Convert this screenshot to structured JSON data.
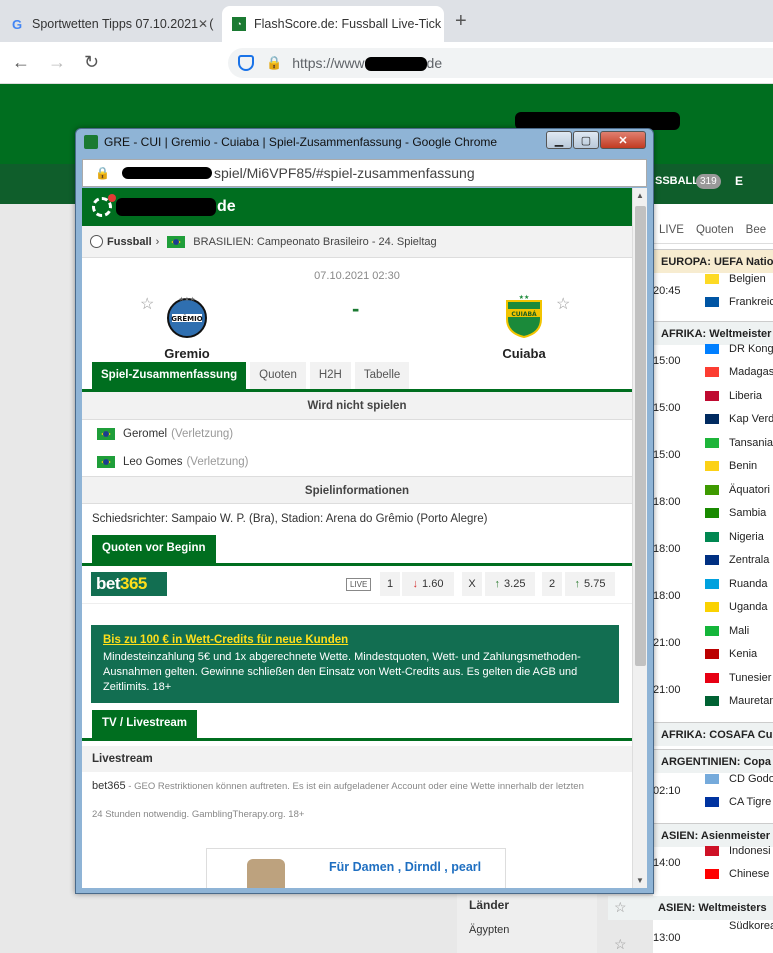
{
  "browser": {
    "tabs": [
      {
        "title": "Sportwetten Tipps 07.10.2021 - (",
        "icon": "google-icon"
      },
      {
        "title": "FlashScore.de: Fussball Live-Tick",
        "icon": "flashscore-icon"
      }
    ],
    "address": {
      "prefix": "https://www",
      "suffix": "de"
    }
  },
  "background_page": {
    "nav": {
      "football": "SSBALL",
      "count": "319",
      "other": "E"
    },
    "subtabs": [
      "LIVE",
      "Quoten",
      "Bee"
    ],
    "leagues": [
      {
        "name": "EUROPA: UEFA Natio",
        "style": "gold"
      },
      {
        "name": "AFRIKA: Weltmeister",
        "style": "plain"
      },
      {
        "name": "AFRIKA: COSAFA Cup",
        "style": "plain"
      },
      {
        "name": "ARGENTINIEN: Copa",
        "style": "plain"
      },
      {
        "name": "ASIEN: Asienmeister",
        "style": "plain"
      }
    ],
    "matches": [
      {
        "time": "20:45",
        "home": "Belgien",
        "away": "Frankreic"
      },
      {
        "time": "15:00",
        "home": "DR Kong",
        "away": "Madagas"
      },
      {
        "time": "15:00",
        "home": "Liberia",
        "away": "Kap Verd"
      },
      {
        "time": "15:00",
        "home": "Tansania",
        "away": "Benin"
      },
      {
        "time": "18:00",
        "home": "Äquatori",
        "away": "Sambia"
      },
      {
        "time": "18:00",
        "home": "Nigeria",
        "away": "Zentrala"
      },
      {
        "time": "18:00",
        "home": "Ruanda",
        "away": "Uganda"
      },
      {
        "time": "21:00",
        "home": "Mali",
        "away": "Kenia"
      },
      {
        "time": "21:00",
        "home": "Tunesier",
        "away": "Mauretan"
      },
      {
        "time": "02:10",
        "home": "CD Godo",
        "away": "CA Tigre"
      },
      {
        "time": "14:00",
        "home": "Indonesi",
        "away": "Chinese"
      },
      {
        "time": "13:00",
        "home": "Südkorea",
        "away": ""
      }
    ],
    "side": {
      "title": "Länder",
      "item": "Ägypten"
    },
    "asia_league": "ASIEN: Weltmeisters"
  },
  "popup": {
    "title": "GRE - CUI | Gremio - Cuiaba | Spiel-Zusammenfassung - Google Chrome",
    "url_suffix": "spiel/Mi6VPF85/#spiel-zusammenfassung",
    "logo_domain": "de",
    "breadcrumb": {
      "sport": "Fussball",
      "league": "BRASILIEN: Campeonato Brasileiro - 24. Spieltag"
    },
    "match": {
      "date": "07.10.2021 02:30",
      "home": "Gremio",
      "away": "Cuiaba",
      "score": "-"
    },
    "tabs": [
      "Spiel-Zusammenfassung",
      "Quoten",
      "H2H",
      "Tabelle"
    ],
    "not_playing": {
      "header": "Wird nicht spielen",
      "players": [
        {
          "name": "Geromel",
          "reason": "(Verletzung)"
        },
        {
          "name": "Leo Gomes",
          "reason": "(Verletzung)"
        }
      ]
    },
    "info": {
      "header": "Spielinformationen",
      "text": "Schiedsrichter: Sampaio W. P. (Bra), Stadion: Arena do Grêmio (Porto Alegre)"
    },
    "odds": {
      "header": "Quoten vor Beginn",
      "bookmaker": "bet365",
      "live": "LIVE",
      "home_label": "1",
      "home_val": "1.60",
      "draw_label": "X",
      "draw_val": "3.25",
      "away_label": "2",
      "away_val": "5.75"
    },
    "promo": {
      "title": "Bis zu 100 € in Wett-Credits für neue Kunden",
      "body": "Mindesteinzahlung 5€ und 1x abgerechnete Wette. Mindestquoten, Wett- und Zahlungsmethoden-Ausnahmen gelten. Gewinne schließen den Einsatz von Wett-Credits aus. Es gelten die AGB und Zeitlimits. 18+"
    },
    "tv": {
      "header": "TV / Livestream",
      "subheader": "Livestream",
      "provider": "bet365",
      "text1": " - GEO Restriktionen können auftreten. Es ist ein aufgeladener Account oder eine Wette innerhalb der letzten",
      "text2": "24 Stunden notwendig. GamblingTherapy.org. 18+"
    },
    "ad": {
      "text": "Für Damen , Dirndl , pearl"
    }
  }
}
